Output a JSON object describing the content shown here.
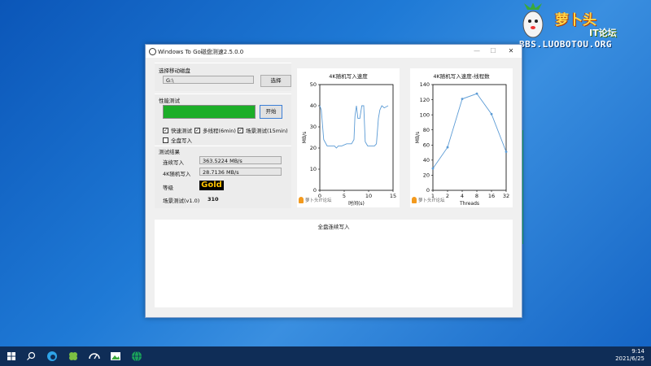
{
  "brand": {
    "name": "萝卜头",
    "sub": "IT论坛",
    "url": "BBS.LUOBOTOU.ORG"
  },
  "window": {
    "title": "Windows To Go磁盘测速2.5.0.0",
    "disk_section": {
      "label": "选择移动磁盘",
      "path_value": "G:\\",
      "select_button": "选择"
    },
    "perf_section": {
      "label": "性能测试",
      "progress": 1.0,
      "start_button": "开始",
      "options": [
        {
          "label": "快速测试",
          "checked": true
        },
        {
          "label": "多线程(6min)",
          "checked": true
        },
        {
          "label": "场景测试(15min)",
          "checked": true
        },
        {
          "label": "全盘写入",
          "checked": false
        }
      ]
    },
    "results": {
      "label": "测试结果",
      "seq_write_label": "连续写入",
      "seq_write_value": "363.5224 MB/s",
      "rand4k_label": "4K随机写入",
      "rand4k_value": "28.7136 MB/s",
      "grade_label": "等级",
      "grade_value": "Gold",
      "scene_label": "场景测试(v1.0)",
      "scene_value": "310"
    },
    "watermark": {
      "name": "萝卜头IT论坛",
      "sub": "Luobotou IT Forum"
    },
    "bottom_panel_title": "全盘连续写入"
  },
  "chart_data": [
    {
      "type": "line",
      "title": "4K随机写入速度",
      "xlabel": "时间(s)",
      "ylabel": "MB/s",
      "xlim": [
        0,
        15
      ],
      "ylim": [
        0,
        50
      ],
      "xticks": [
        0,
        5,
        10,
        15
      ],
      "yticks": [
        0,
        10,
        20,
        30,
        40,
        50
      ],
      "x": [
        0,
        0.3,
        0.8,
        1.5,
        2.2,
        3,
        3.4,
        3.8,
        4.5,
        5.5,
        6.5,
        7,
        7.2,
        7.5,
        7.8,
        8.2,
        8.6,
        9,
        9.3,
        9.8,
        10.5,
        11.2,
        11.6,
        12,
        12.3,
        12.7,
        13.2,
        14
      ],
      "y": [
        40,
        38,
        24,
        21,
        21,
        21,
        20,
        21,
        21,
        22,
        22,
        24,
        35,
        40,
        34,
        34,
        40,
        40,
        23,
        21,
        21,
        21,
        22,
        34,
        38,
        40,
        39,
        40
      ]
    },
    {
      "type": "line",
      "title": "4K随机写入速度-线程数",
      "xlabel": "Threads",
      "ylabel": "MB/s",
      "ylim": [
        0,
        140
      ],
      "categories": [
        "1",
        "2",
        "4",
        "8",
        "16",
        "32"
      ],
      "yticks": [
        0,
        20,
        40,
        60,
        80,
        100,
        120,
        140
      ],
      "values": [
        29,
        57,
        121,
        128,
        101,
        51
      ]
    }
  ],
  "taskbar": {
    "icons": [
      "windows-start-icon",
      "search-icon",
      "edge-browser-icon",
      "clover-app-icon",
      "speedometer-app-icon",
      "image-app-icon",
      "globe-app-icon"
    ],
    "time": "9:14",
    "date": "2021/6/25"
  }
}
